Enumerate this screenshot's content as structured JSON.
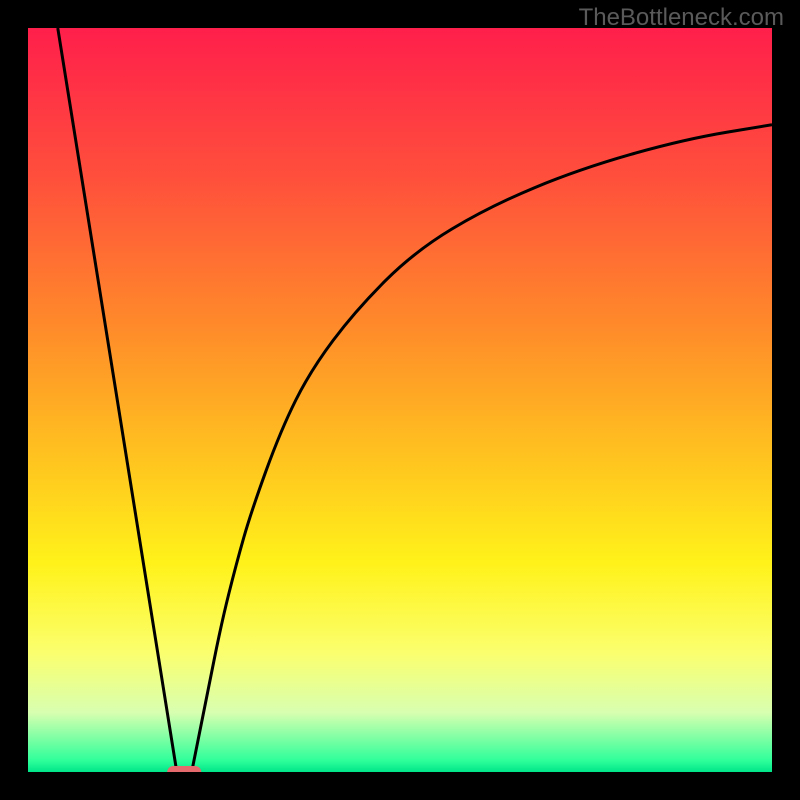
{
  "watermark": "TheBottleneck.com",
  "chart_data": {
    "type": "line",
    "title": "",
    "xlabel": "",
    "ylabel": "",
    "xlim": [
      0,
      100
    ],
    "ylim": [
      0,
      100
    ],
    "series": [
      {
        "name": "left-branch",
        "x": [
          4,
          20
        ],
        "y": [
          100,
          0
        ]
      },
      {
        "name": "right-branch",
        "x": [
          22,
          24,
          26,
          28,
          30,
          34,
          38,
          44,
          52,
          62,
          74,
          88,
          100
        ],
        "y": [
          0,
          10,
          20,
          28,
          35,
          46,
          54,
          62,
          70,
          76,
          81,
          85,
          87
        ]
      }
    ],
    "marker": {
      "name": "minimum-marker",
      "x": 21,
      "y": 0,
      "color": "#e46a6e"
    },
    "gradient_stops": [
      {
        "offset": 0.0,
        "color": "#ff1f4b"
      },
      {
        "offset": 0.2,
        "color": "#ff4f3c"
      },
      {
        "offset": 0.4,
        "color": "#ff8a2a"
      },
      {
        "offset": 0.58,
        "color": "#ffc41f"
      },
      {
        "offset": 0.72,
        "color": "#fff21a"
      },
      {
        "offset": 0.84,
        "color": "#fbff6e"
      },
      {
        "offset": 0.92,
        "color": "#d8ffb0"
      },
      {
        "offset": 0.985,
        "color": "#2eff9a"
      },
      {
        "offset": 1.0,
        "color": "#00e589"
      }
    ],
    "bottom_band": {
      "top_y": 98,
      "color_top": "#fbff6e",
      "color_bottom": "#00e589"
    }
  }
}
